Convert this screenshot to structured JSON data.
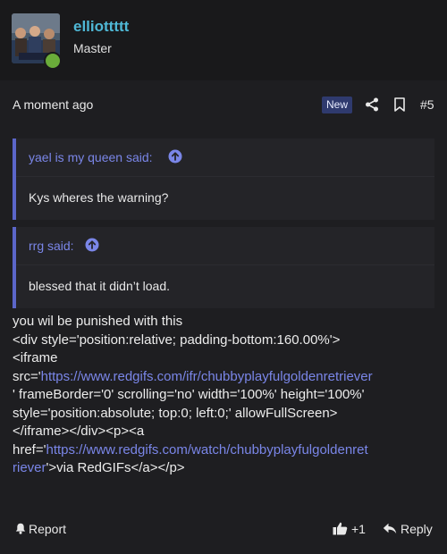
{
  "user": {
    "name": "elliottttt",
    "title": "Master"
  },
  "post": {
    "time": "A moment ago",
    "badge": "New",
    "number": "#5"
  },
  "quotes": [
    {
      "author": "yael is my queen said:",
      "text": "Kys wheres the warning?"
    },
    {
      "author": "rrg said:",
      "text": "blessed that it didn’t load."
    }
  ],
  "body": {
    "line1": "you wil be punished with this",
    "line2": "<div style='position:relative; padding-bottom:160.00%'>",
    "line3": "<iframe",
    "line4_prefix": "src='",
    "line4_link": "https://www.redgifs.com/ifr/chubbyplayfulgoldenretriever",
    "line5": "' frameBorder='0' scrolling='no' width='100%' height='100%'",
    "line6": "style='position:absolute; top:0; left:0;' allowFullScreen>",
    "line7": "</iframe></div><p><a",
    "line8_prefix": "href='",
    "line8_link": "https://www.redgifs.com/watch/chubbyplayfulgoldenret",
    "line9_link": "riever",
    "line9_suffix": "'>via RedGIFs</a></p>"
  },
  "footer": {
    "report_label": "Report",
    "like_count": "+1",
    "reply_label": "Reply"
  },
  "colors": {
    "username": "#4fb8d6",
    "accent": "#7a86e8",
    "quote_bar": "#5b66c9",
    "online": "#6aac3a",
    "badge_bg": "#2f3a6e"
  },
  "icons": [
    "share-icon",
    "bookmark-icon",
    "arrow-up-circle-icon",
    "bell-icon",
    "thumbs-up-icon",
    "reply-arrow-icon"
  ]
}
